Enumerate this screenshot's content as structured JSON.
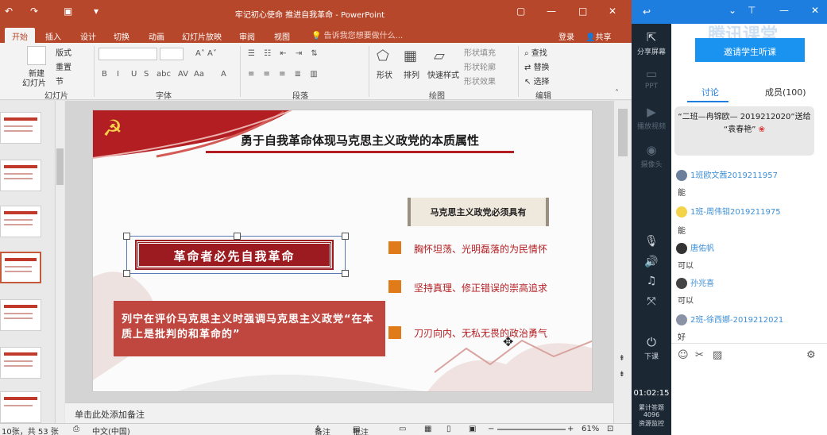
{
  "window": {
    "title": "牢记初心使命 推进自我革命 - PowerPoint"
  },
  "tabs": [
    "开始",
    "插入",
    "设计",
    "切换",
    "动画",
    "幻灯片放映",
    "审阅",
    "视图"
  ],
  "tellme": "告诉我您想要做什么...",
  "account": {
    "login": "登录",
    "share": "共享"
  },
  "ribbon": {
    "slides_group": "幻灯片",
    "new_slide": "新建",
    "slide_item": "幻灯片",
    "layout": "版式",
    "reset": "重置",
    "section": "节",
    "font_group": "字体",
    "font_buttons": [
      "B",
      "I",
      "U",
      "S",
      "abc",
      "AV",
      "Aa",
      "A"
    ],
    "paragraph_group": "段落",
    "drawing_group": "绘图",
    "shape": "形状",
    "arrange": "排列",
    "quick_styles": "快速样式",
    "fill": "形状填充",
    "outline": "形状轮廓",
    "effects": "形状效果",
    "editing_group": "编辑",
    "find": "查找",
    "replace": "替换",
    "select": "选择"
  },
  "slide": {
    "title": "勇于自我革命体现马克思主义政党的本质属性",
    "banner": "革命者必先自我革命",
    "quote": "列宁在评价马克思主义时强调马克思主义政党“在本质上是批判的和革命的”",
    "scroll_label": "马克思主义政党必须具有",
    "points": [
      "胸怀坦荡、光明磊落的为民情怀",
      "坚持真理、修正错误的崇高追求",
      "刀刃向内、无私无畏的政治勇气"
    ]
  },
  "notes_placeholder": "单击此处添加备注",
  "status": {
    "slide_count": "10张，共 53 张",
    "language": "中文(中国)",
    "notes": "备注",
    "comments": "批注",
    "zoom": "61%"
  },
  "tencent": {
    "brand": "腾讯课堂",
    "invite": "邀请学生听课",
    "tabs": [
      "讨论",
      "成员(100)"
    ],
    "gift_text": "“二班—冉锦欧— 2019212020”送给",
    "gift_target": "“袁春艳”",
    "sidebar": [
      "分享屏幕",
      "PPT",
      "播放视频",
      "摄像头",
      "下课"
    ],
    "messages": [
      {
        "name": "1班欧文茜2019211957",
        "text": "能"
      },
      {
        "name": "1班-周伟钼2019211975",
        "text": "能"
      },
      {
        "name": "唐佑帆",
        "text": "可以"
      },
      {
        "name": "孙兆喜",
        "text": "可以"
      },
      {
        "name": "2班-徐西娜-2019212021",
        "text": "好"
      }
    ],
    "timer": "01:02:15",
    "cum_label": "累计答题",
    "cum_value": "4096",
    "monitor": "资源监控"
  },
  "colors": {
    "ppt_red": "#b7472a",
    "accent_red": "#b31e23",
    "orange": "#e07b1a",
    "tx_blue": "#1e7ee0"
  }
}
